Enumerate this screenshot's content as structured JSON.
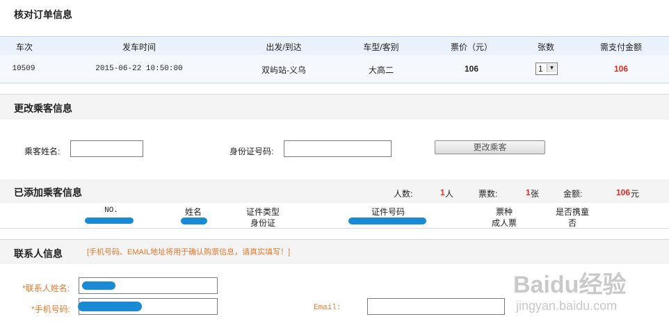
{
  "order": {
    "title": "核对订单信息",
    "headers": [
      "车次",
      "发车时间",
      "出发/到达",
      "车型/客别",
      "票价（元）",
      "张数",
      "需支付金额"
    ],
    "row": {
      "train": "10509",
      "time": "2015-06-22 10:50:00",
      "route": "双屿站-义乌",
      "type": "大高二",
      "price": "106",
      "count": "1",
      "total": "106"
    }
  },
  "change_passenger": {
    "title": "更改乘客信息",
    "name_label": "乘客姓名:",
    "id_label": "身份证号码:",
    "button": "更改乘客"
  },
  "added": {
    "title": "已添加乘客信息",
    "people_label": "人数:",
    "people_value": "1",
    "people_unit": "人",
    "tickets_label": "票数:",
    "tickets_value": "1",
    "tickets_unit": "张",
    "amount_label": "金额:",
    "amount_value": "106",
    "amount_unit": "元",
    "headers": [
      "NO.",
      "姓名",
      "证件类型",
      "证件号码",
      "票种",
      "是否携童"
    ],
    "row": {
      "id_type": "身份证",
      "ticket_type": "成人票",
      "with_child": "否"
    }
  },
  "contact": {
    "title": "联系人信息",
    "note": "[手机号码、EMAIL地址将用于确认购票信息，请真实填写！]",
    "name_label": "*联系人姓名:",
    "phone_label": "*手机号码:",
    "email_label": "Email:"
  },
  "watermark": {
    "brand": "Baidu经验",
    "url": "jingyan.baidu.com"
  },
  "colors": {
    "accent_red": "#e8281e",
    "orange": "#e6782a",
    "header_blue": "#e9f1fb",
    "redact_blue": "#1a8ad4"
  }
}
